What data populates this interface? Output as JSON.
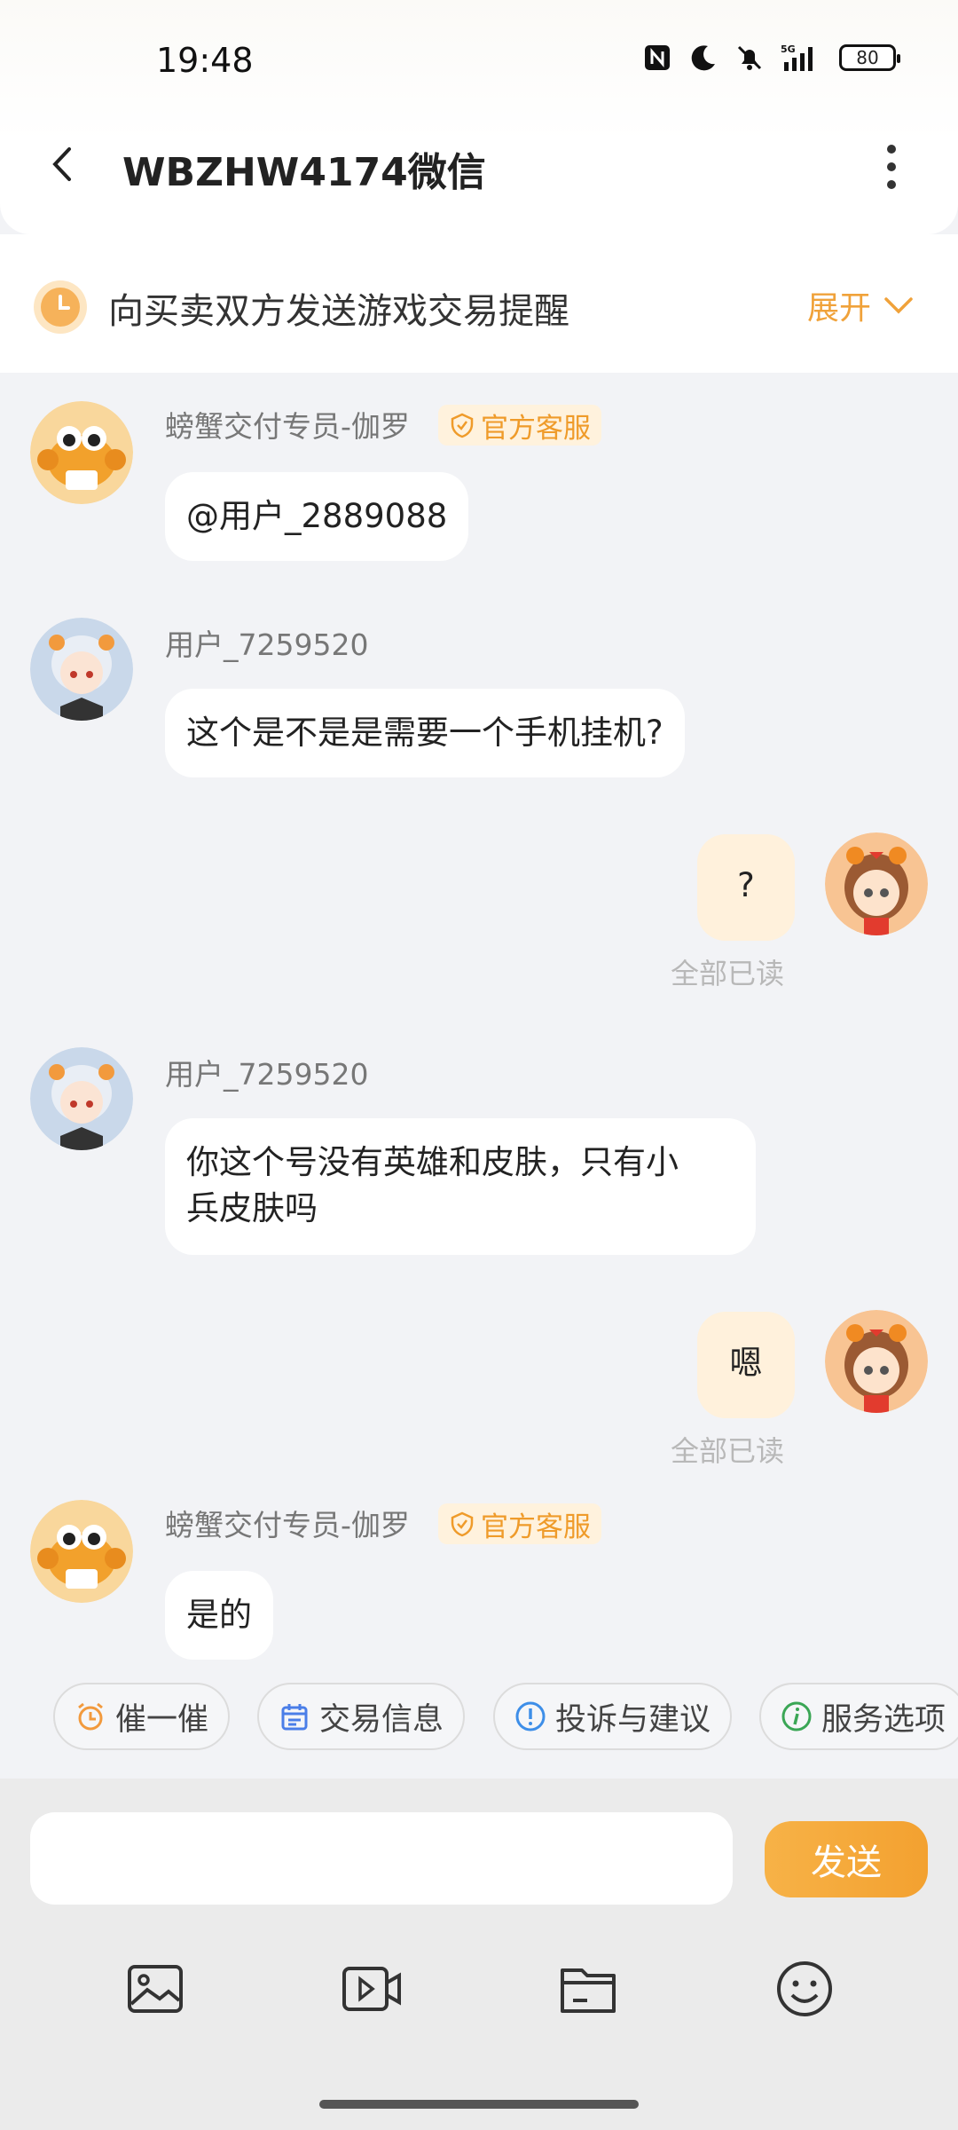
{
  "status": {
    "time": "19:48",
    "battery": "80",
    "network": "5G"
  },
  "header": {
    "title": "WBZHW4174微信"
  },
  "reminder": {
    "text": "向买卖双方发送游戏交易提醒",
    "expand": "展开"
  },
  "messages": [
    {
      "sender": "螃蟹交付专员-伽罗",
      "badge": "官方客服",
      "text": "@用户_2889088"
    },
    {
      "sender": "用户_7259520",
      "text": "这个是不是是需要一个手机挂机?"
    },
    {
      "text": "?",
      "read": "全部已读"
    },
    {
      "sender": "用户_7259520",
      "line1": "你这个号没有英雄和皮肤，只有小",
      "line2": "兵皮肤吗"
    },
    {
      "text": "嗯",
      "read": "全部已读"
    },
    {
      "sender": "螃蟹交付专员-伽罗",
      "badge": "官方客服",
      "text": "是的"
    }
  ],
  "chips": [
    "催一催",
    "交易信息",
    "投诉与建议",
    "服务选项"
  ],
  "input": {
    "send": "发送",
    "placeholder": ""
  },
  "colors": {
    "accent": "#f0a23a",
    "bubble_me": "#fff1dc",
    "badge_bg": "#fff2dd"
  },
  "icons": [
    "image-icon",
    "video-icon",
    "folder-icon",
    "emoji-icon"
  ]
}
